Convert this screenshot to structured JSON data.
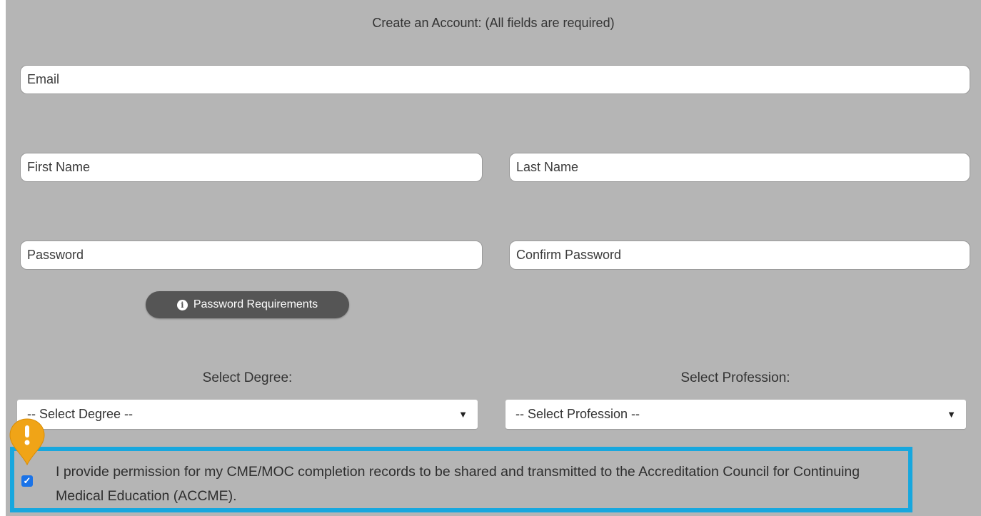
{
  "form": {
    "title": "Create an Account: (All fields are required)"
  },
  "fields": {
    "email_placeholder": "Email",
    "first_name_placeholder": "First Name",
    "last_name_placeholder": "Last Name",
    "password_placeholder": "Password",
    "confirm_password_placeholder": "Confirm Password"
  },
  "password_requirements": {
    "label": "Password Requirements",
    "icon": "info-icon"
  },
  "degree": {
    "label": "Select Degree:",
    "selected": "-- Select Degree --"
  },
  "profession": {
    "label": "Select Profession:",
    "selected": "-- Select Profession --"
  },
  "consent": {
    "checked": true,
    "text": "I provide permission for my CME/MOC completion records to be shared and transmitted to the Accreditation Council for Continuing Medical Education (ACCME)."
  },
  "marker": {
    "icon": "exclamation-marker-icon",
    "symbol": "!"
  },
  "colors": {
    "panel_bg": "#b5b5b5",
    "highlight_border": "#17a7de",
    "marker": "#f0a417",
    "checkbox": "#1a73e8",
    "button_bg": "#555555"
  }
}
